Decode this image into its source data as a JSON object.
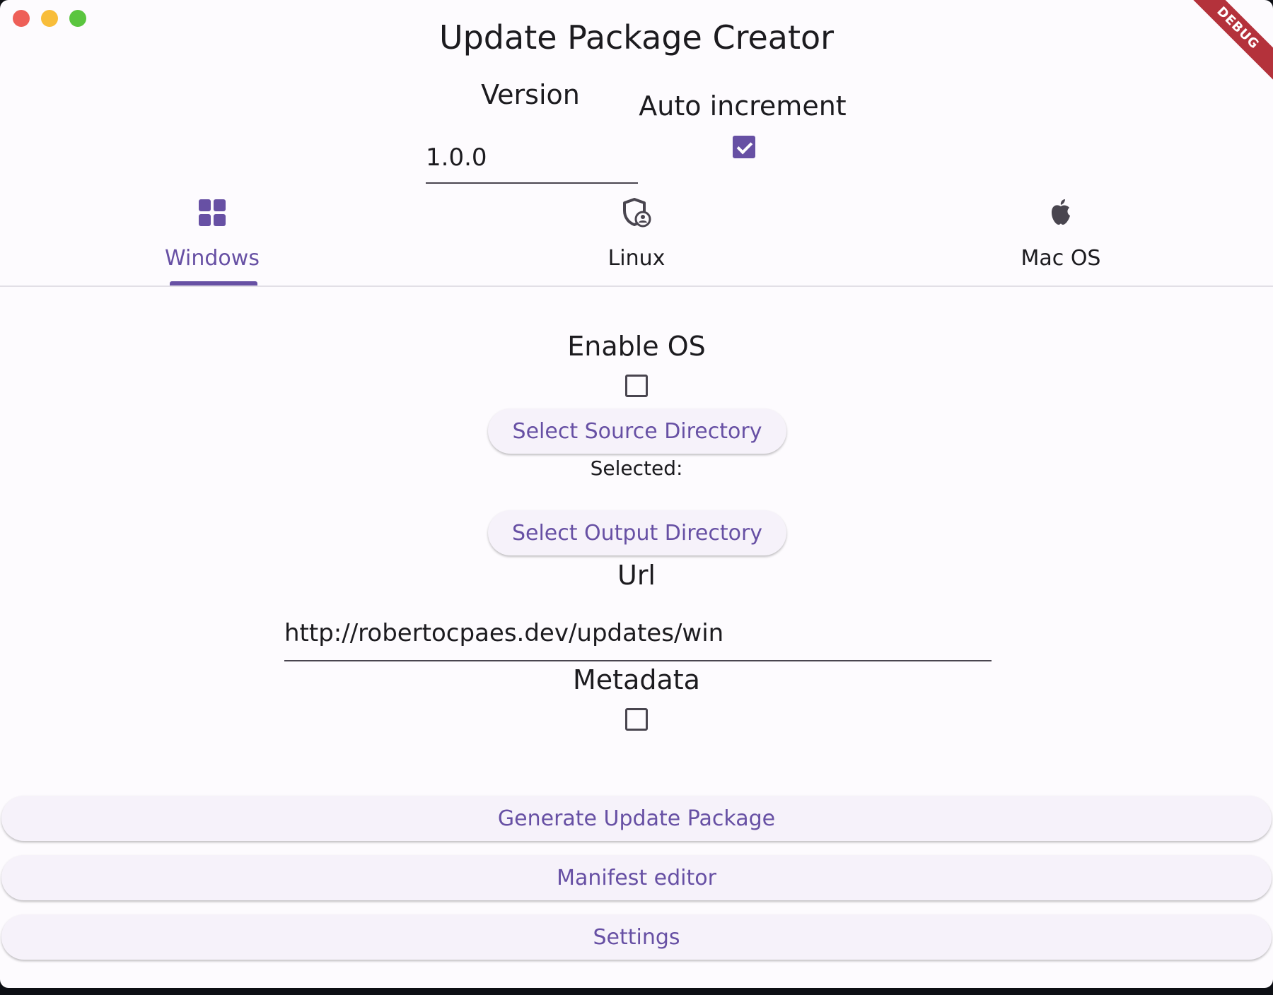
{
  "window": {
    "title": "Update Package Creator",
    "debug_banner": "DEBUG"
  },
  "version": {
    "label": "Version",
    "value": "1.0.0"
  },
  "auto_increment": {
    "label": "Auto increment",
    "checked": true
  },
  "tabs": [
    {
      "label": "Windows",
      "icon": "windows-icon",
      "active": true
    },
    {
      "label": "Linux",
      "icon": "shield-person-icon",
      "active": false
    },
    {
      "label": "Mac OS",
      "icon": "apple-icon",
      "active": false
    }
  ],
  "platform": {
    "enable_label": "Enable OS",
    "enable_checked": false,
    "select_source_label": "Select Source Directory",
    "selected_text": "Selected:",
    "select_output_label": "Select Output Directory",
    "url_label": "Url",
    "url_value": "http://robertocpaes.dev/updates/win",
    "metadata_label": "Metadata",
    "metadata_checked": false
  },
  "actions": {
    "generate_label": "Generate Update Package",
    "manifest_label": "Manifest editor",
    "settings_label": "Settings"
  },
  "colors": {
    "accent": "#6750a4",
    "background": "#fdfbfe",
    "button_bg": "#f6f2fa"
  }
}
